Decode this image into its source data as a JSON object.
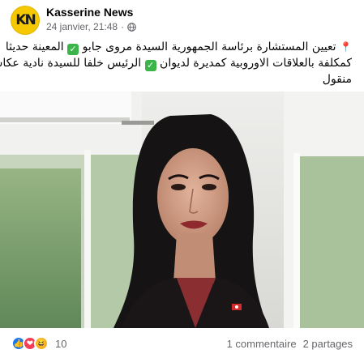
{
  "post": {
    "page_name": "Kasserine News",
    "avatar_text": "KN",
    "timestamp": "24 janvier, 21:48",
    "separator": "·",
    "privacy_icon": "globe-icon",
    "caption": {
      "line1": "تعيين المستشارة برئاسة الجمهورية السيدة مروى جابو",
      "line2_a": "المعينة حديثا",
      "line2_b": "كمكلفة بالعلاقات الاوروبية كمديرة لديوان",
      "line2_c": "الرئيس خلفا للسيدة نادية عكاشة",
      "line3": "منقول"
    },
    "caption_icons": [
      "pin-icon",
      "check-mark-icon"
    ]
  },
  "footer": {
    "reaction_icons": [
      "like-icon",
      "love-icon",
      "haha-icon"
    ],
    "reaction_count": "10",
    "comments": "1 commentaire",
    "shares": "2 partages"
  },
  "colors": {
    "accent": "#1877f2",
    "secondary_text": "#65676b",
    "check_green": "#3bb54a",
    "avatar_yellow": "#f5c800"
  }
}
